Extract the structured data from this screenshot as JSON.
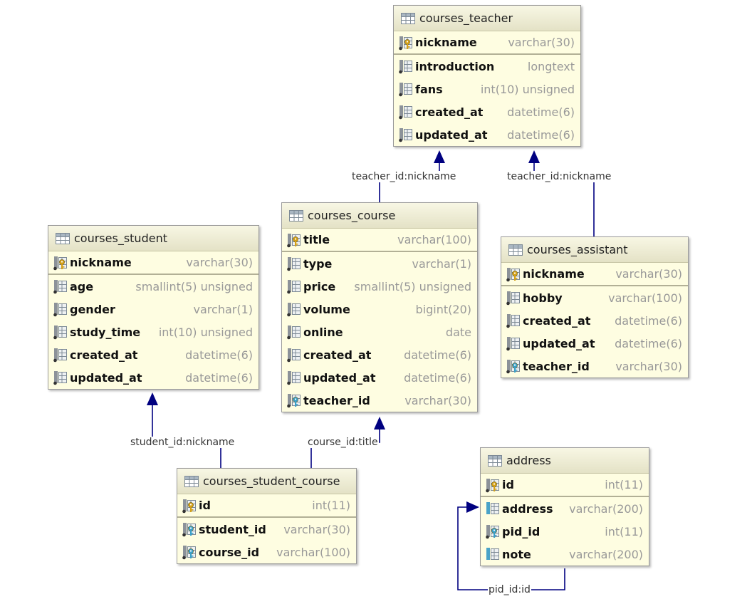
{
  "entities": {
    "teacher": {
      "title": "courses_teacher",
      "columns": [
        {
          "name": "nickname",
          "type": "varchar(30)",
          "kind": "pk"
        },
        {
          "name": "introduction",
          "type": "longtext",
          "kind": "col"
        },
        {
          "name": "fans",
          "type": "int(10) unsigned",
          "kind": "col"
        },
        {
          "name": "created_at",
          "type": "datetime(6)",
          "kind": "col"
        },
        {
          "name": "updated_at",
          "type": "datetime(6)",
          "kind": "col"
        }
      ]
    },
    "course": {
      "title": "courses_course",
      "columns": [
        {
          "name": "title",
          "type": "varchar(100)",
          "kind": "pk"
        },
        {
          "name": "type",
          "type": "varchar(1)",
          "kind": "col"
        },
        {
          "name": "price",
          "type": "smallint(5) unsigned",
          "kind": "col"
        },
        {
          "name": "volume",
          "type": "bigint(20)",
          "kind": "col"
        },
        {
          "name": "online",
          "type": "date",
          "kind": "col"
        },
        {
          "name": "created_at",
          "type": "datetime(6)",
          "kind": "col"
        },
        {
          "name": "updated_at",
          "type": "datetime(6)",
          "kind": "col"
        },
        {
          "name": "teacher_id",
          "type": "varchar(30)",
          "kind": "fk"
        }
      ]
    },
    "student": {
      "title": "courses_student",
      "columns": [
        {
          "name": "nickname",
          "type": "varchar(30)",
          "kind": "pk"
        },
        {
          "name": "age",
          "type": "smallint(5) unsigned",
          "kind": "col"
        },
        {
          "name": "gender",
          "type": "varchar(1)",
          "kind": "col"
        },
        {
          "name": "study_time",
          "type": "int(10) unsigned",
          "kind": "col"
        },
        {
          "name": "created_at",
          "type": "datetime(6)",
          "kind": "col"
        },
        {
          "name": "updated_at",
          "type": "datetime(6)",
          "kind": "col"
        }
      ]
    },
    "assistant": {
      "title": "courses_assistant",
      "columns": [
        {
          "name": "nickname",
          "type": "varchar(30)",
          "kind": "pk"
        },
        {
          "name": "hobby",
          "type": "varchar(100)",
          "kind": "col"
        },
        {
          "name": "created_at",
          "type": "datetime(6)",
          "kind": "col"
        },
        {
          "name": "updated_at",
          "type": "datetime(6)",
          "kind": "col"
        },
        {
          "name": "teacher_id",
          "type": "varchar(30)",
          "kind": "fk"
        }
      ]
    },
    "student_course": {
      "title": "courses_student_course",
      "columns": [
        {
          "name": "id",
          "type": "int(11)",
          "kind": "pk"
        },
        {
          "name": "student_id",
          "type": "varchar(30)",
          "kind": "fk"
        },
        {
          "name": "course_id",
          "type": "varchar(100)",
          "kind": "fk"
        }
      ]
    },
    "address": {
      "title": "address",
      "columns": [
        {
          "name": "id",
          "type": "int(11)",
          "kind": "pk"
        },
        {
          "name": "address",
          "type": "varchar(200)",
          "kind": "idx"
        },
        {
          "name": "pid_id",
          "type": "int(11)",
          "kind": "fk"
        },
        {
          "name": "note",
          "type": "varchar(200)",
          "kind": "idx"
        }
      ]
    }
  },
  "links": {
    "course_teacher": "teacher_id:nickname",
    "assistant_teacher": "teacher_id:nickname",
    "sc_student": "student_id:nickname",
    "sc_course": "course_id:title",
    "address_self": "pid_id:id"
  },
  "colors": {
    "link": "#000080",
    "entity_bg": "#fefde1",
    "type_text": "#999999",
    "key_gold": "#d4a017",
    "key_blue": "#3aa0c8"
  }
}
